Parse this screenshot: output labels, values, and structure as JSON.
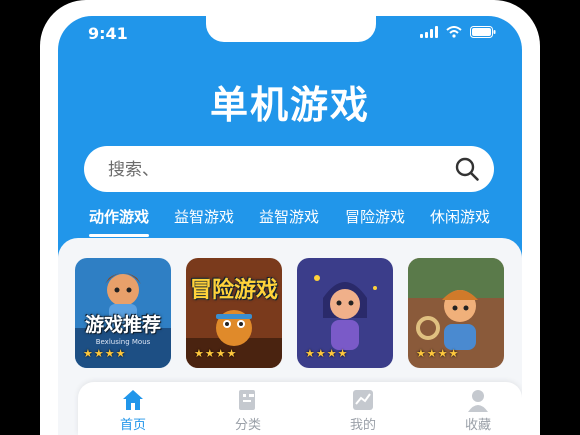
{
  "status_bar": {
    "time": "9:41"
  },
  "app_title": "单机游戏",
  "search": {
    "placeholder": "搜索、"
  },
  "tabs": [
    {
      "label": "动作游戏",
      "active": true
    },
    {
      "label": "益智游戏",
      "active": false
    },
    {
      "label": "益智游戏",
      "active": false
    },
    {
      "label": "冒险游戏",
      "active": false
    },
    {
      "label": "休闲游戏",
      "active": false
    }
  ],
  "game_cards": [
    {
      "title": "游戏推荐",
      "subtitle": "Bexlusing Mous",
      "rating": 4,
      "icon": "hero-character"
    },
    {
      "title": "冒险游戏",
      "rating": 4,
      "icon": "robot-character"
    },
    {
      "title": "",
      "rating": 4,
      "icon": "girl-character"
    },
    {
      "title": "",
      "rating": 4,
      "icon": "boy-character"
    }
  ],
  "bottom_nav": [
    {
      "label": "首页",
      "icon": "home-icon",
      "active": true
    },
    {
      "label": "分类",
      "icon": "category-icon",
      "active": false
    },
    {
      "label": "我的",
      "icon": "profile-chart-icon",
      "active": false
    },
    {
      "label": "收藏",
      "icon": "user-icon",
      "active": false
    }
  ],
  "colors": {
    "primary": "#2196ea",
    "star": "#ffc83d",
    "nav_inactive": "#9aa0a8"
  }
}
